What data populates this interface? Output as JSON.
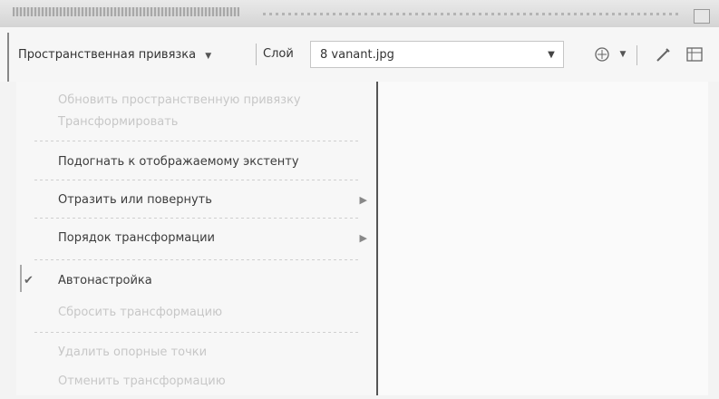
{
  "toolbar": {
    "georeferencing_menu": "Пространственная привязка",
    "layer_label": "Слой",
    "layer_value": "8 vanant.jpg"
  },
  "menu": {
    "items": [
      {
        "label": "Обновить пространственную привязку",
        "enabled": false
      },
      {
        "label": "Трансформировать",
        "enabled": false
      },
      {
        "label": "Подогнать к отображаемому экстенту",
        "enabled": true
      },
      {
        "label": "Отразить или повернуть",
        "enabled": true,
        "submenu": true
      },
      {
        "label": "Порядок трансформации",
        "enabled": true,
        "submenu": true
      },
      {
        "label": "Автонастройка",
        "enabled": true,
        "checked": true
      },
      {
        "label": "Сбросить трансформацию",
        "enabled": false
      },
      {
        "label": "Удалить опорные точки",
        "enabled": false
      },
      {
        "label": "Отменить трансформацию",
        "enabled": false
      }
    ]
  },
  "icons": {
    "dropdown": "chevron-down-icon",
    "control_points": "control-points-icon",
    "link_table": "link-table-icon",
    "edit_link": "edit-link-icon"
  }
}
